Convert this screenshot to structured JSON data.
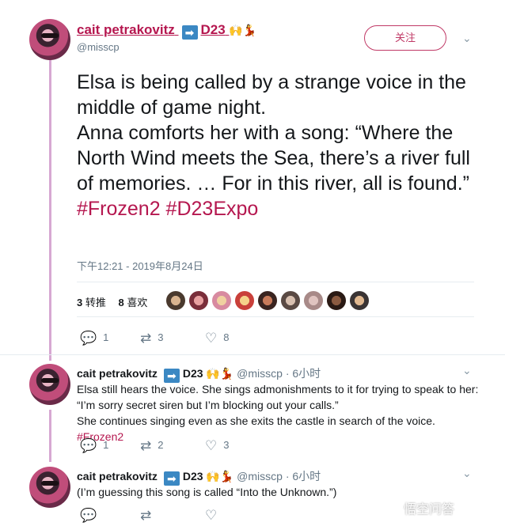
{
  "main_tweet": {
    "display_name": "cait petrakovitz",
    "name_suffix": "D23",
    "handle": "@misscp",
    "follow_label": "关注",
    "text_lines": [
      "Elsa is being called by a strange voice in the middle of game night.",
      "Anna comforts her with a song: “Where the North Wind meets the Sea, there’s a river full of memories. … For in this river, all is found.”"
    ],
    "hashtags": "#Frozen2 #D23Expo",
    "timestamp": "下午12:21 - 2019年8月24日",
    "retweet_count": "3",
    "retweet_label": "转推",
    "like_count": "8",
    "like_label": "喜欢",
    "reply_action_count": "1",
    "retweet_action_count": "3",
    "like_action_count": "8"
  },
  "replies": [
    {
      "display_name": "cait petrakovitz",
      "name_suffix": "D23",
      "meta": "@misscp · 6小时",
      "line1": "Elsa still hears the voice. She sings admonishments to it for trying to speak to her:",
      "line2": "“I’m sorry secret siren but I’m blocking out your calls.”",
      "line3": "She continues singing even as she exits the castle in search of the voice.",
      "tag": "#Frozen2",
      "reply_count": "1",
      "retweet_count": "2",
      "like_count": "3"
    },
    {
      "display_name": "cait petrakovitz",
      "name_suffix": "D23",
      "meta": "@misscp · 6小时",
      "line1": "(I’m guessing this song is called “Into the Unknown.”)"
    }
  ],
  "icons": {
    "reply": "reply-icon",
    "retweet": "retweet-icon",
    "like": "heart-icon",
    "caret": "chevron-down-icon"
  },
  "watermark": "悟空问答",
  "colors": {
    "brand": "#b5174f",
    "thread_line": "#d7a8d2",
    "muted": "#657786"
  }
}
